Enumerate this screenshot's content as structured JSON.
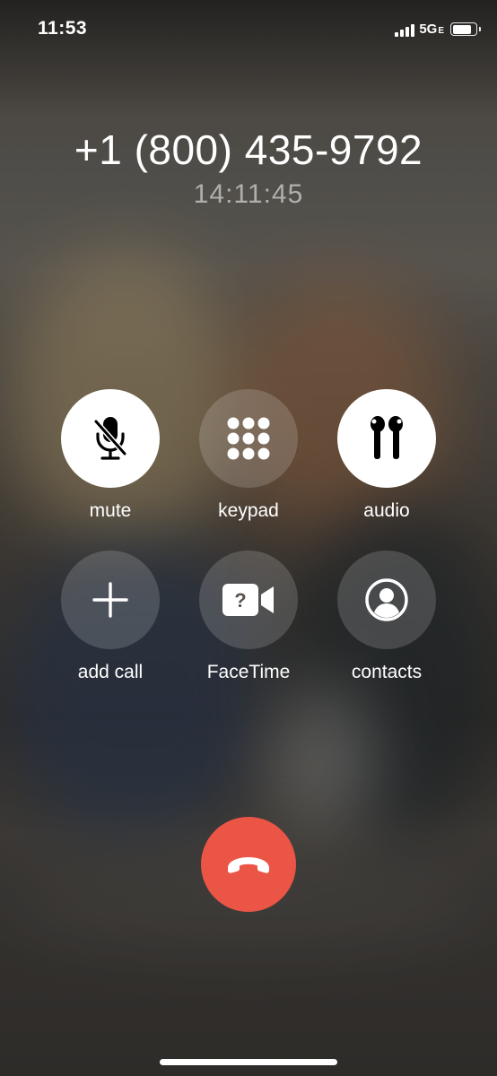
{
  "status_bar": {
    "time": "11:53",
    "network": "5G",
    "network_sub": "E",
    "signal_bars": 4,
    "battery_level_percent": 85
  },
  "call": {
    "number": "+1 (800) 435-9792",
    "duration": "14:11:45"
  },
  "controls": [
    {
      "label": "mute",
      "icon": "mic-slash-icon",
      "active": true
    },
    {
      "label": "keypad",
      "icon": "keypad-icon",
      "active": false
    },
    {
      "label": "audio",
      "icon": "airpods-icon",
      "active": true
    },
    {
      "label": "add call",
      "icon": "plus-icon",
      "active": false
    },
    {
      "label": "FaceTime",
      "icon": "facetime-video-icon",
      "active": false
    },
    {
      "label": "contacts",
      "icon": "contact-person-icon",
      "active": false
    }
  ],
  "end_call": {
    "icon": "phone-hangup-icon",
    "color": "#eb5545"
  },
  "colors": {
    "active_button": "#ffffff",
    "inactive_button": "rgba(255,255,255,0.16)",
    "end_call": "#eb5545"
  }
}
